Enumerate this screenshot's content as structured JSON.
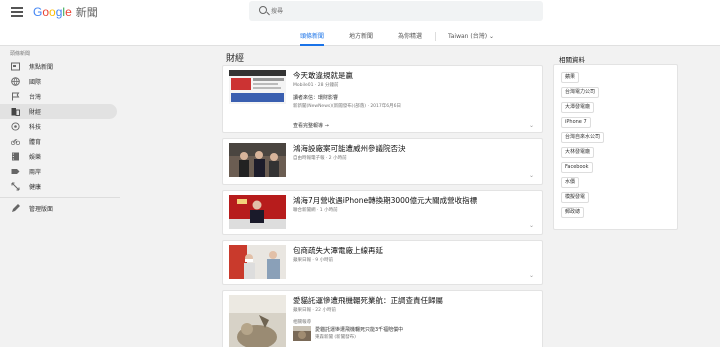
{
  "header": {
    "logo_google": [
      "G",
      "o",
      "o",
      "g",
      "l",
      "e"
    ],
    "logo_news": "新聞",
    "search_placeholder": "搜尋"
  },
  "tabs": [
    {
      "label": "頭條新聞",
      "active": true
    },
    {
      "label": "地方新聞",
      "active": false
    },
    {
      "label": "為你精選",
      "active": false
    },
    {
      "label": "Taiwan (台灣)",
      "active": false
    }
  ],
  "sidebar": {
    "heading": "頭條新聞",
    "items": [
      {
        "label": "焦點新聞",
        "icon": "newspaper-icon"
      },
      {
        "label": "國際",
        "icon": "globe-icon"
      },
      {
        "label": "台灣",
        "icon": "flag-icon"
      },
      {
        "label": "財經",
        "icon": "business-icon",
        "active": true
      },
      {
        "label": "科技",
        "icon": "tech-icon"
      },
      {
        "label": "體育",
        "icon": "bike-icon"
      },
      {
        "label": "娛樂",
        "icon": "film-icon"
      },
      {
        "label": "兩岸",
        "icon": "label-icon"
      },
      {
        "label": "健康",
        "icon": "dna-icon"
      }
    ],
    "manage_label": "管理版面"
  },
  "section_title": "財經",
  "articles": [
    {
      "title": "今天敢違規就是贏",
      "source": "Mobile01",
      "time": "28 分鐘前",
      "sub_title": "讀者來信：環財影響",
      "sub_source": "新新聞(NewNews)(新聞發布)(部落)",
      "sub_time": "2017年6月6日",
      "coverage": "查看完整報導"
    },
    {
      "title": "鴻海設廠案可能遭威州參議院否決",
      "source": "自由時報電子報",
      "time": "2 小時前"
    },
    {
      "title": "鴻海7月營收遇iPhone轉換期3000億元大關成營收指標",
      "source": "聯合新聞網",
      "time": "1 小時前"
    },
    {
      "title": "包商疏失大潭電廠上線再延",
      "source": "蘋果日報",
      "time": "9 小時前"
    },
    {
      "title": "愛貓託運慘遭飛機輾死業航：正調查責任歸屬",
      "source": "蘋果日報",
      "time": "22 小時前",
      "related_label": "相關報導",
      "sub_title": "愛貓託運慘遭飛機輾死只能3千福賠償中",
      "sub_source": "東森新聞 (新聞發布)"
    }
  ],
  "related": {
    "title": "相關資料",
    "chips": [
      "蘋果",
      "台灣電力公司",
      "大潭發電廠",
      "iPhone 7",
      "台灣自來水公司",
      "大林發電廠",
      "Facebook",
      "水價",
      "模擬發電",
      "郵政總"
    ]
  }
}
